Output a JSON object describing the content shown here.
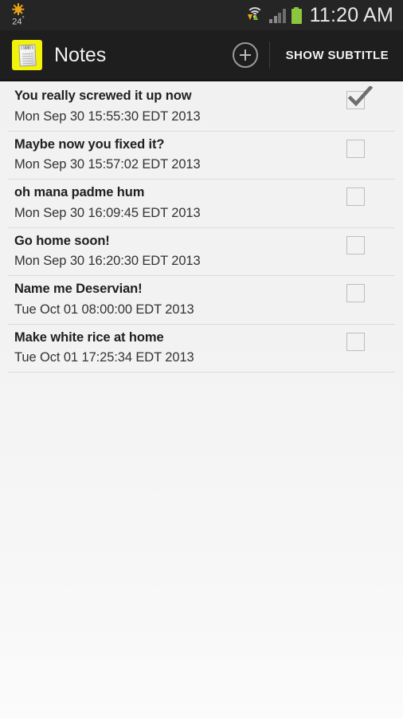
{
  "status_bar": {
    "weather": {
      "icon": "sun-icon",
      "temperature": "24",
      "degree_symbol": "°"
    },
    "icons": {
      "wifi": "wifi-icon",
      "data_transfer": "data-transfer-arrows-icon",
      "signal": "cellular-signal-icon",
      "battery": "battery-icon"
    },
    "clock": "11:20 AM",
    "background": "#252525",
    "battery_color": "#8cc63e"
  },
  "action_bar": {
    "app_icon": "notepad-icon",
    "app_icon_background": "#f2f20a",
    "title": "Notes",
    "add_button": {
      "icon": "plus-circle-icon",
      "label": ""
    },
    "show_subtitle_label": "SHOW SUBTITLE",
    "background": "#1e1e1e"
  },
  "notes": [
    {
      "title": "You really screwed it up now",
      "date": "Mon Sep 30 15:55:30 EDT 2013",
      "checked": true
    },
    {
      "title": "Maybe now you fixed it?",
      "date": "Mon Sep 30 15:57:02 EDT 2013",
      "checked": false
    },
    {
      "title": "oh mana padme hum",
      "date": "Mon Sep 30 16:09:45 EDT 2013",
      "checked": false
    },
    {
      "title": "Go home soon!",
      "date": "Mon Sep 30 16:20:30 EDT 2013",
      "checked": false
    },
    {
      "title": "Name me Deservian!",
      "date": "Tue Oct 01 08:00:00 EDT 2013",
      "checked": false
    },
    {
      "title": "Make white rice at home",
      "date": "Tue Oct 01 17:25:34 EDT 2013",
      "checked": false
    }
  ],
  "theme": {
    "list_background": "#f2f2f2",
    "divider": "#dcdcdc",
    "title_color": "#1f1f1f",
    "date_color": "#333333",
    "checkbox_border": "#bdbdbd",
    "checkmark_color": "#6e6e6e"
  }
}
